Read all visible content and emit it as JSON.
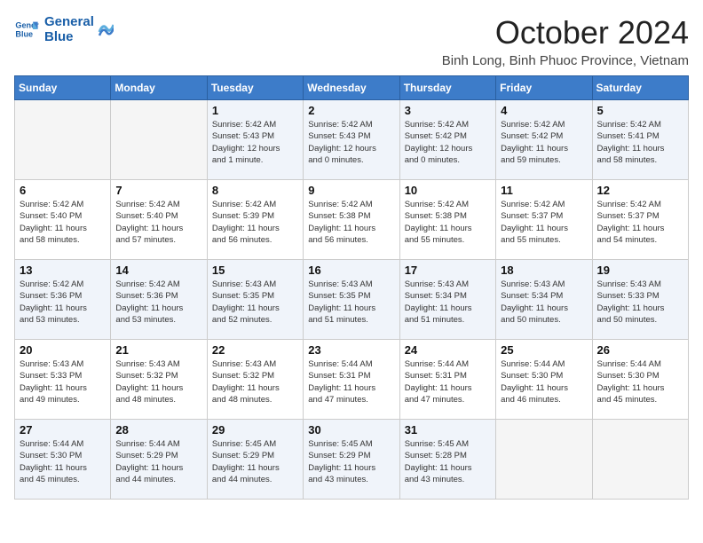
{
  "logo": {
    "line1": "General",
    "line2": "Blue"
  },
  "title": "October 2024",
  "location": "Binh Long, Binh Phuoc Province, Vietnam",
  "days_of_week": [
    "Sunday",
    "Monday",
    "Tuesday",
    "Wednesday",
    "Thursday",
    "Friday",
    "Saturday"
  ],
  "weeks": [
    [
      {
        "day": "",
        "info": ""
      },
      {
        "day": "",
        "info": ""
      },
      {
        "day": "1",
        "info": "Sunrise: 5:42 AM\nSunset: 5:43 PM\nDaylight: 12 hours\nand 1 minute."
      },
      {
        "day": "2",
        "info": "Sunrise: 5:42 AM\nSunset: 5:43 PM\nDaylight: 12 hours\nand 0 minutes."
      },
      {
        "day": "3",
        "info": "Sunrise: 5:42 AM\nSunset: 5:42 PM\nDaylight: 12 hours\nand 0 minutes."
      },
      {
        "day": "4",
        "info": "Sunrise: 5:42 AM\nSunset: 5:42 PM\nDaylight: 11 hours\nand 59 minutes."
      },
      {
        "day": "5",
        "info": "Sunrise: 5:42 AM\nSunset: 5:41 PM\nDaylight: 11 hours\nand 58 minutes."
      }
    ],
    [
      {
        "day": "6",
        "info": "Sunrise: 5:42 AM\nSunset: 5:40 PM\nDaylight: 11 hours\nand 58 minutes."
      },
      {
        "day": "7",
        "info": "Sunrise: 5:42 AM\nSunset: 5:40 PM\nDaylight: 11 hours\nand 57 minutes."
      },
      {
        "day": "8",
        "info": "Sunrise: 5:42 AM\nSunset: 5:39 PM\nDaylight: 11 hours\nand 56 minutes."
      },
      {
        "day": "9",
        "info": "Sunrise: 5:42 AM\nSunset: 5:38 PM\nDaylight: 11 hours\nand 56 minutes."
      },
      {
        "day": "10",
        "info": "Sunrise: 5:42 AM\nSunset: 5:38 PM\nDaylight: 11 hours\nand 55 minutes."
      },
      {
        "day": "11",
        "info": "Sunrise: 5:42 AM\nSunset: 5:37 PM\nDaylight: 11 hours\nand 55 minutes."
      },
      {
        "day": "12",
        "info": "Sunrise: 5:42 AM\nSunset: 5:37 PM\nDaylight: 11 hours\nand 54 minutes."
      }
    ],
    [
      {
        "day": "13",
        "info": "Sunrise: 5:42 AM\nSunset: 5:36 PM\nDaylight: 11 hours\nand 53 minutes."
      },
      {
        "day": "14",
        "info": "Sunrise: 5:42 AM\nSunset: 5:36 PM\nDaylight: 11 hours\nand 53 minutes."
      },
      {
        "day": "15",
        "info": "Sunrise: 5:43 AM\nSunset: 5:35 PM\nDaylight: 11 hours\nand 52 minutes."
      },
      {
        "day": "16",
        "info": "Sunrise: 5:43 AM\nSunset: 5:35 PM\nDaylight: 11 hours\nand 51 minutes."
      },
      {
        "day": "17",
        "info": "Sunrise: 5:43 AM\nSunset: 5:34 PM\nDaylight: 11 hours\nand 51 minutes."
      },
      {
        "day": "18",
        "info": "Sunrise: 5:43 AM\nSunset: 5:34 PM\nDaylight: 11 hours\nand 50 minutes."
      },
      {
        "day": "19",
        "info": "Sunrise: 5:43 AM\nSunset: 5:33 PM\nDaylight: 11 hours\nand 50 minutes."
      }
    ],
    [
      {
        "day": "20",
        "info": "Sunrise: 5:43 AM\nSunset: 5:33 PM\nDaylight: 11 hours\nand 49 minutes."
      },
      {
        "day": "21",
        "info": "Sunrise: 5:43 AM\nSunset: 5:32 PM\nDaylight: 11 hours\nand 48 minutes."
      },
      {
        "day": "22",
        "info": "Sunrise: 5:43 AM\nSunset: 5:32 PM\nDaylight: 11 hours\nand 48 minutes."
      },
      {
        "day": "23",
        "info": "Sunrise: 5:44 AM\nSunset: 5:31 PM\nDaylight: 11 hours\nand 47 minutes."
      },
      {
        "day": "24",
        "info": "Sunrise: 5:44 AM\nSunset: 5:31 PM\nDaylight: 11 hours\nand 47 minutes."
      },
      {
        "day": "25",
        "info": "Sunrise: 5:44 AM\nSunset: 5:30 PM\nDaylight: 11 hours\nand 46 minutes."
      },
      {
        "day": "26",
        "info": "Sunrise: 5:44 AM\nSunset: 5:30 PM\nDaylight: 11 hours\nand 45 minutes."
      }
    ],
    [
      {
        "day": "27",
        "info": "Sunrise: 5:44 AM\nSunset: 5:30 PM\nDaylight: 11 hours\nand 45 minutes."
      },
      {
        "day": "28",
        "info": "Sunrise: 5:44 AM\nSunset: 5:29 PM\nDaylight: 11 hours\nand 44 minutes."
      },
      {
        "day": "29",
        "info": "Sunrise: 5:45 AM\nSunset: 5:29 PM\nDaylight: 11 hours\nand 44 minutes."
      },
      {
        "day": "30",
        "info": "Sunrise: 5:45 AM\nSunset: 5:29 PM\nDaylight: 11 hours\nand 43 minutes."
      },
      {
        "day": "31",
        "info": "Sunrise: 5:45 AM\nSunset: 5:28 PM\nDaylight: 11 hours\nand 43 minutes."
      },
      {
        "day": "",
        "info": ""
      },
      {
        "day": "",
        "info": ""
      }
    ]
  ]
}
